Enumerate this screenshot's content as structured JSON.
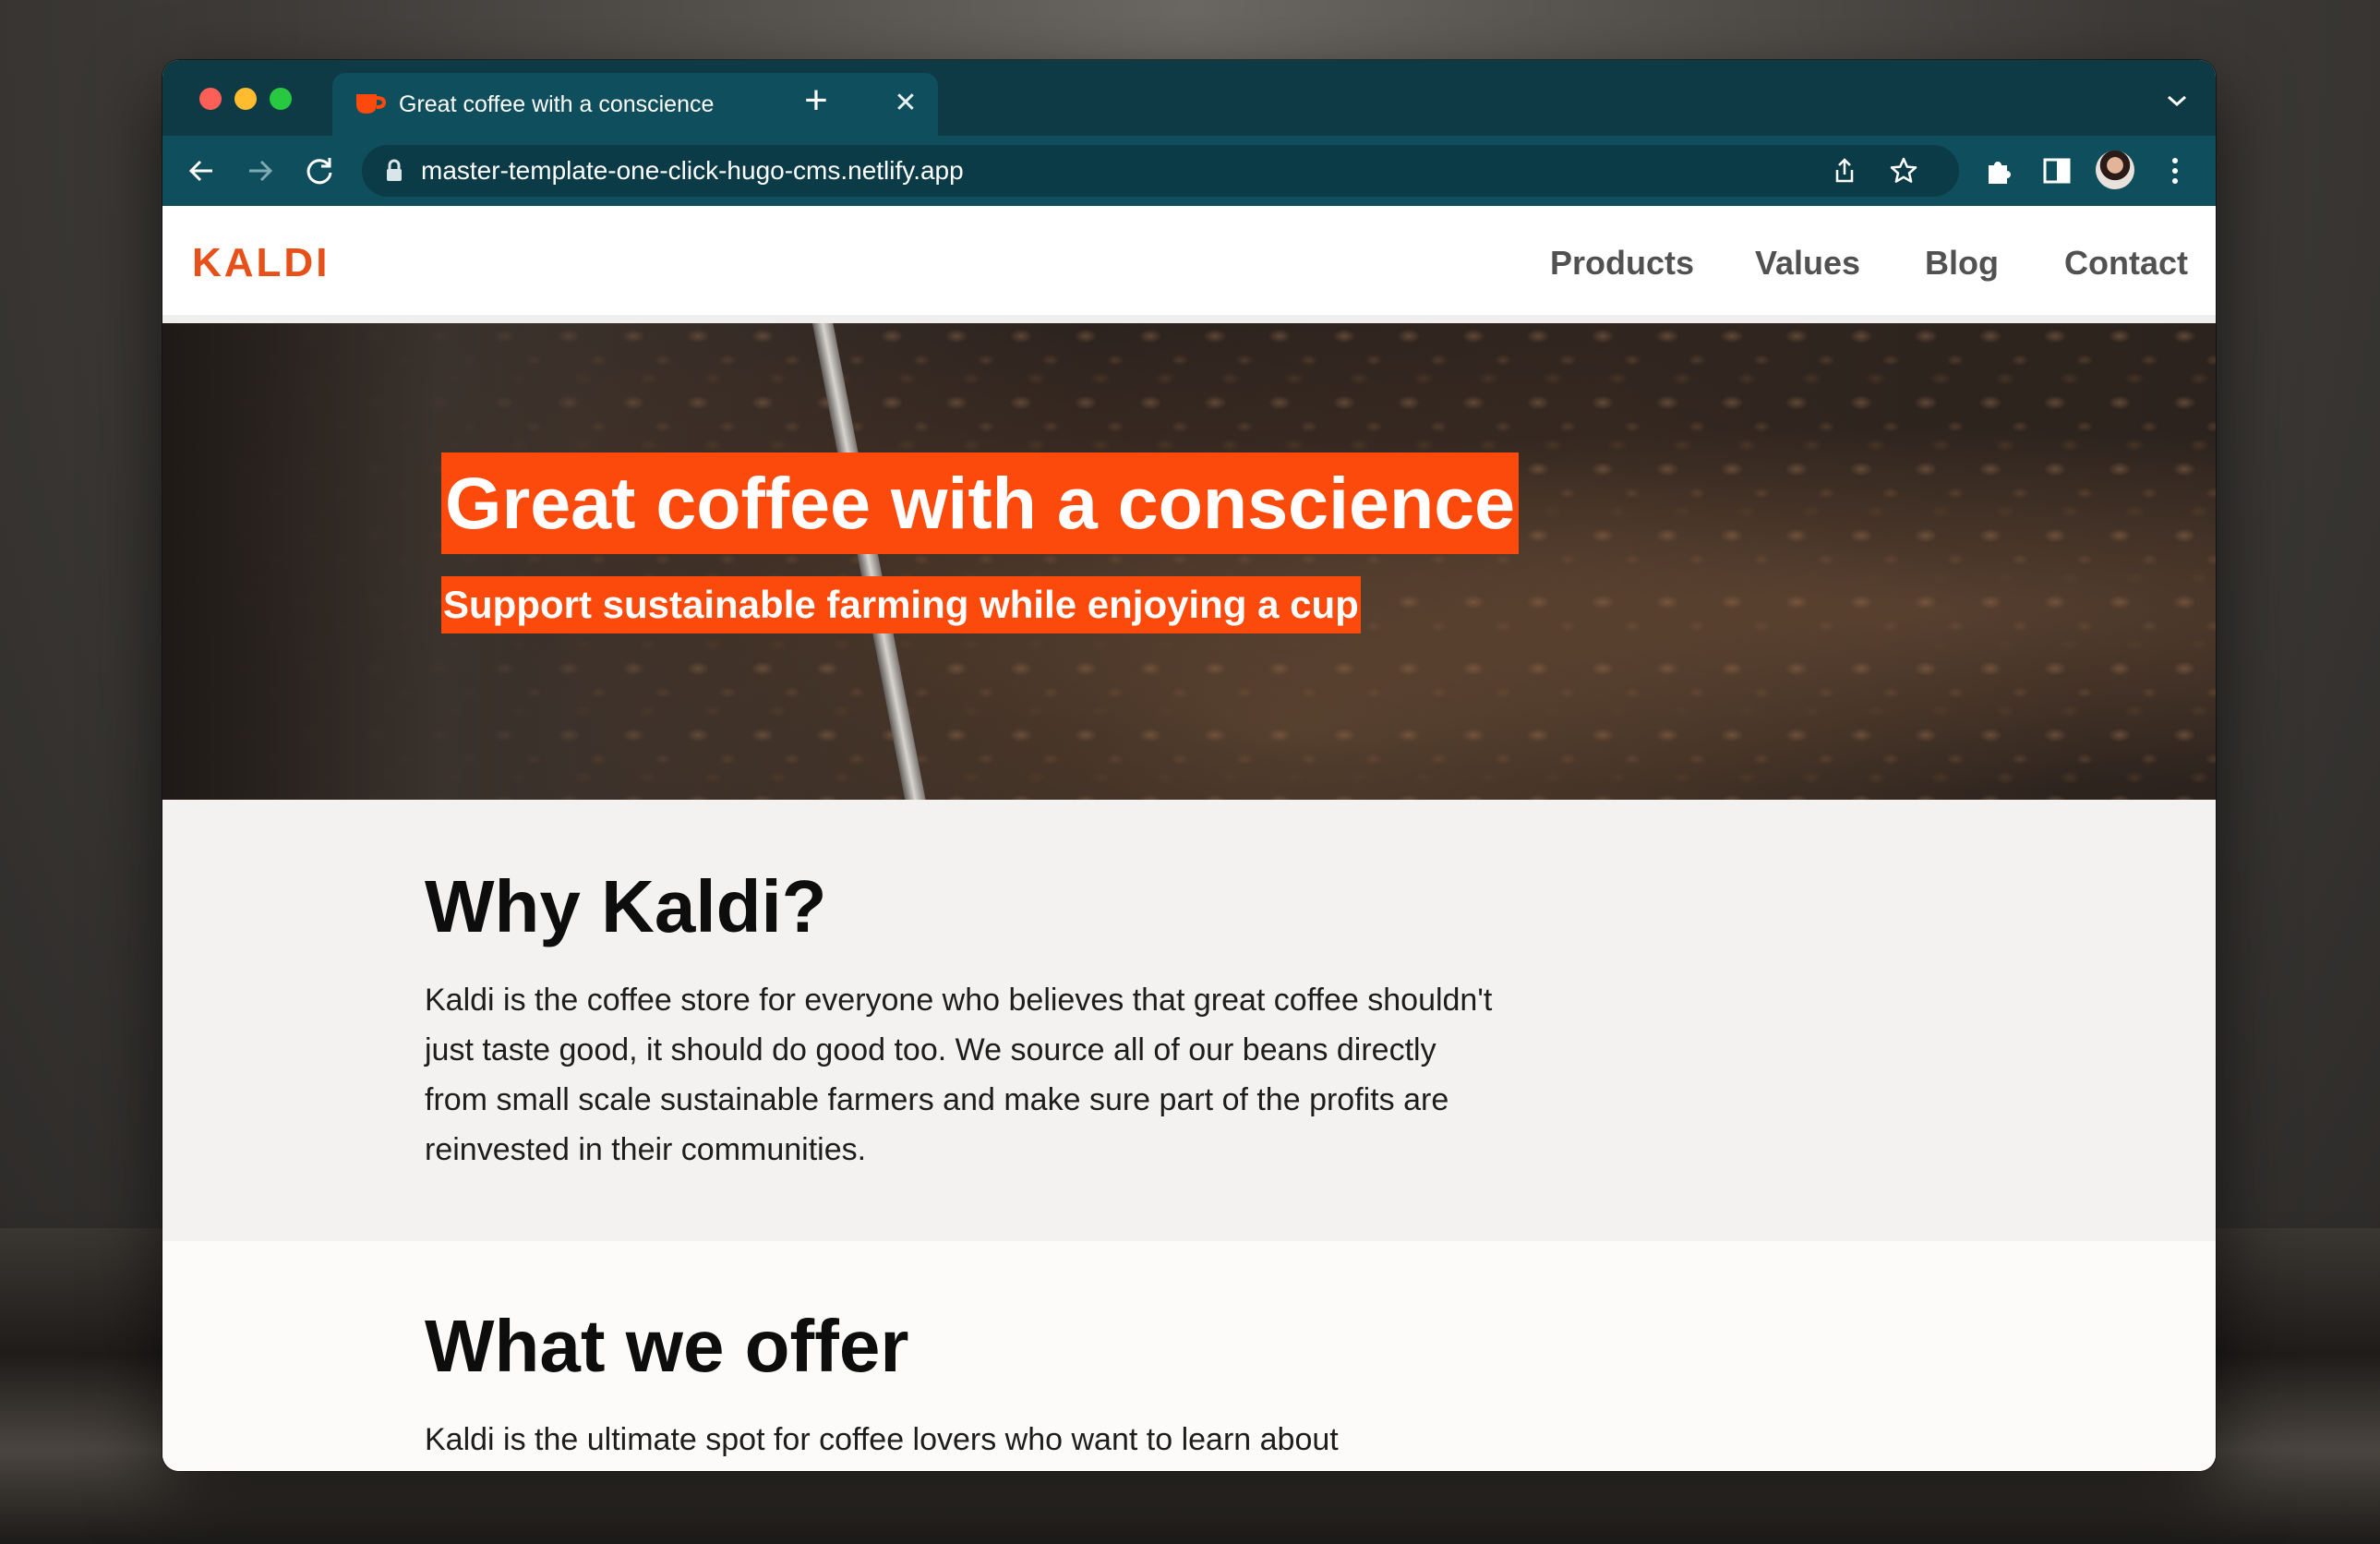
{
  "browser": {
    "tab_title": "Great coffee with a conscience",
    "close_glyph": "✕",
    "new_tab_glyph": "+",
    "url": "master-template-one-click-hugo-cms.netlify.app",
    "icons": [
      "back-icon",
      "forward-icon",
      "reload-icon",
      "lock-icon",
      "share-icon",
      "star-icon",
      "extensions-icon",
      "sidepanel-icon",
      "kebab-menu-icon",
      "chevron-down-icon"
    ]
  },
  "site": {
    "logo": "KALDI",
    "nav": [
      "Products",
      "Values",
      "Blog",
      "Contact"
    ],
    "brand_color": "#fb4a0b"
  },
  "hero": {
    "title": "Great coffee with a conscience",
    "subtitle": "Support sustainable farming while enjoying a cup"
  },
  "sections": [
    {
      "heading": "Why Kaldi?",
      "text": "Kaldi is the coffee store for everyone who believes that great coffee shouldn't just taste good, it should do good too. We source all of our beans directly from small scale sustainable farmers and make sure part of the profits are reinvested in their communities."
    },
    {
      "heading": "What we offer",
      "text": "Kaldi is the ultimate spot for coffee lovers who want to learn about"
    }
  ]
}
